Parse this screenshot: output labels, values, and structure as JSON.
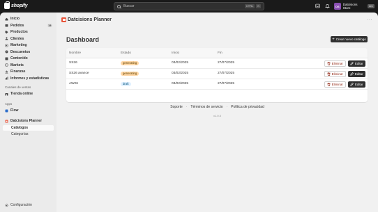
{
  "topbar": {
    "logo_text": "shopify",
    "search_placeholder": "Buscar",
    "shortcut_key1": "CTRL",
    "shortcut_key2": "K",
    "store_initials": "DS",
    "store_name": "Datcisions Store",
    "store_badge": "dev"
  },
  "sidebar": {
    "items": [
      {
        "label": "Inicio"
      },
      {
        "label": "Pedidos",
        "count": "15"
      },
      {
        "label": "Productos"
      },
      {
        "label": "Clientes"
      },
      {
        "label": "Marketing"
      },
      {
        "label": "Descuentos"
      },
      {
        "label": "Contenido"
      },
      {
        "label": "Markets"
      },
      {
        "label": "Finanzas"
      },
      {
        "label": "Informes y estadísticas"
      }
    ],
    "sales_channels_label": "Canales de ventas",
    "online_store": "Tienda online",
    "apps_label": "Apps",
    "flow": "Flow",
    "app_name": "Datcisions Planner",
    "catalogs": "Catálogos",
    "categories": "Categorías",
    "settings": "Configuración"
  },
  "main": {
    "app_title": "Datcisions Planner",
    "more": "···",
    "page_title": "Dashboard",
    "create_button": "Crear nuevo catálogo",
    "table": {
      "headers": [
        "Nombre",
        "Estado",
        "Inicio",
        "Fin"
      ],
      "rows": [
        {
          "name": "SS26",
          "status": "generating",
          "start": "03/02/2025",
          "end": "27/07/2025"
        },
        {
          "name": "SS26 avance",
          "status": "generating",
          "start": "03/02/2025",
          "end": "27/07/2025"
        },
        {
          "name": "AW26",
          "status": "draft",
          "start": "03/02/2025",
          "end": "27/07/2025"
        }
      ],
      "delete_label": "Eliminar",
      "edit_label": "Editar"
    },
    "footer": {
      "support": "Soporte",
      "terms": "Términos de servicio",
      "privacy": "Política de privacidad",
      "separator": "·",
      "version": "v1.0.0"
    }
  },
  "colors": {
    "dark": "#1a1a1a",
    "generating_badge": "#ffd6a4",
    "draft_badge": "#e0f0ff",
    "app_icon": "#e8543a",
    "store_avatar": "#8a4fb2"
  }
}
